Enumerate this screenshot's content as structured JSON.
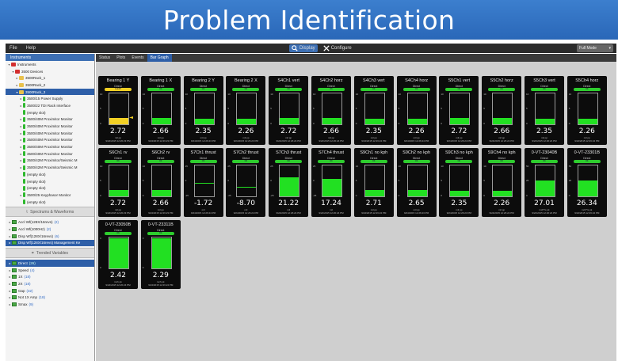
{
  "banner": {
    "title": "Problem Identification"
  },
  "menu": {
    "file": "File",
    "help": "Help",
    "display": "Display",
    "configure": "Configure",
    "mode": "Full Mode"
  },
  "left": {
    "header": "Instruments",
    "tree": [
      {
        "label": "Instruments",
        "icon": "red",
        "indent": 0,
        "tri": "▾"
      },
      {
        "label": "3500 Devices",
        "icon": "red",
        "indent": 1,
        "tri": "▾"
      },
      {
        "label": "3500Rack_1",
        "icon": "yel",
        "indent": 2,
        "tri": "▸"
      },
      {
        "label": "3500Rack_2",
        "icon": "yel",
        "indent": 2,
        "tri": "▸"
      },
      {
        "label": "3500Rack_3",
        "icon": "yel",
        "indent": 2,
        "tri": "▾",
        "selected": true
      },
      {
        "label": "3500/15 Power Supply",
        "icon": "grn",
        "indent": 3,
        "tri": "▸"
      },
      {
        "label": "3500/22 TDI Rack Interface",
        "icon": "grn",
        "indent": 3,
        "tri": "▸"
      },
      {
        "label": "(empty slot)",
        "icon": "grn",
        "indent": 3,
        "tri": ""
      },
      {
        "label": "3500/40M Proximitor Monitor",
        "icon": "grn",
        "indent": 3,
        "tri": "▸"
      },
      {
        "label": "3500/40M Proximitor Monitor",
        "icon": "grn",
        "indent": 3,
        "tri": "▸"
      },
      {
        "label": "3500/40M Proximitor Monitor",
        "icon": "grn",
        "indent": 3,
        "tri": "▸"
      },
      {
        "label": "3500/40M Proximitor Monitor",
        "icon": "grn",
        "indent": 3,
        "tri": "▸"
      },
      {
        "label": "3500/40M Proximitor Monitor",
        "icon": "grn",
        "indent": 3,
        "tri": "▸"
      },
      {
        "label": "3500/40M Proximitor Monitor",
        "icon": "grn",
        "indent": 3,
        "tri": "▸"
      },
      {
        "label": "3500/42M Proximitor/Seismic M",
        "icon": "grn",
        "indent": 3,
        "tri": "▸"
      },
      {
        "label": "3500/42M Proximitor/Seismic M",
        "icon": "grn",
        "indent": 3,
        "tri": "▸"
      },
      {
        "label": "(empty slot)",
        "icon": "grn",
        "indent": 3,
        "tri": ""
      },
      {
        "label": "(empty slot)",
        "icon": "grn",
        "indent": 3,
        "tri": ""
      },
      {
        "label": "(empty slot)",
        "icon": "grn",
        "indent": 3,
        "tri": ""
      },
      {
        "label": "3500/25 Keyphasor Monitor",
        "icon": "grn",
        "indent": 3,
        "tri": "▸"
      },
      {
        "label": "(empty slot)",
        "icon": "grn",
        "indent": 3,
        "tri": ""
      }
    ],
    "spectrums_bar": "Spectrums & Waveforms",
    "waveforms": [
      {
        "label": "Accl Wf(128X/16revs)",
        "count": "(2)"
      },
      {
        "label": "Accl Wf(1000Hz)",
        "count": "(2)"
      },
      {
        "label": "Disp Wf(128X/16revs)",
        "count": "(6)"
      },
      {
        "label": "Disp Wf(128X/16revs) Management Ke",
        "count": "",
        "selected": true
      }
    ],
    "trended_bar": "Trended Variables",
    "variables": [
      {
        "label": "Direct",
        "count": "(26)",
        "selected": true
      },
      {
        "label": "Speed",
        "count": "(4)"
      },
      {
        "label": "1X",
        "count": "(18)"
      },
      {
        "label": "2X",
        "count": "(18)"
      },
      {
        "label": "Gap",
        "count": "(32)"
      },
      {
        "label": "Not 1X Amp",
        "count": "(18)"
      },
      {
        "label": "Smax",
        "count": "(9)"
      }
    ]
  },
  "tabs": [
    "Status",
    "Plots",
    "Events",
    "Bar Graph"
  ],
  "cards": [
    {
      "name": "Bearing 1 Y",
      "badge": "ALERT",
      "alert": true,
      "value": "2.72",
      "unit": "mil pp",
      "level": 0.2,
      "ticks": [
        "10",
        "5",
        "0"
      ],
      "ts": "9/24/2015 12:26:23 PM"
    },
    {
      "name": "Bearing 1 X",
      "badge": "OK",
      "value": "2.66",
      "unit": "mil pp",
      "level": 0.2,
      "ticks": [
        "10",
        "5",
        "0"
      ],
      "ts": "9/24/2015 12:26:23 PM"
    },
    {
      "name": "Bearing 2 Y",
      "badge": "OK",
      "value": "2.35",
      "unit": "mil pp",
      "level": 0.18,
      "ticks": [
        "10",
        "5",
        "0"
      ],
      "ts": "9/24/2015 12:26:23 PM"
    },
    {
      "name": "Bearing 2 X",
      "badge": "OK",
      "value": "2.26",
      "unit": "mil pp",
      "level": 0.17,
      "ticks": [
        "10",
        "5",
        "0"
      ],
      "ts": "9/24/2015 12:26:23 PM"
    },
    {
      "name": "S4Ch1 vert",
      "badge": "OK",
      "value": "2.72",
      "unit": "mil pp",
      "level": 0.2,
      "ticks": [
        "10",
        "5",
        "0"
      ],
      "ts": "9/24/2015 12:26:24 PM"
    },
    {
      "name": "S4Ch2 horz",
      "badge": "OK",
      "value": "2.66",
      "unit": "mil pp",
      "level": 0.2,
      "ticks": [
        "10",
        "5",
        "0"
      ],
      "ts": "9/24/2015 12:26:24 PM"
    },
    {
      "name": "S4Ch3 vert",
      "badge": "OK",
      "value": "2.35",
      "unit": "mil pp",
      "level": 0.18,
      "ticks": [
        "10",
        "5",
        "0"
      ],
      "ts": "9/24/2015 12:26:24 PM"
    },
    {
      "name": "S4Ch4 horz",
      "badge": "OK",
      "value": "2.26",
      "unit": "mil pp",
      "level": 0.17,
      "ticks": [
        "10",
        "5",
        "0"
      ],
      "ts": "9/24/2015 12:26:24 PM"
    },
    {
      "name": "S5Ch1 vert",
      "badge": "OK",
      "value": "2.72",
      "unit": "mil pp",
      "level": 0.2,
      "ticks": [
        "10",
        "5",
        "0"
      ],
      "ts": "9/24/2015 12:26:24 PM"
    },
    {
      "name": "S5Ch2 horz",
      "badge": "OK",
      "value": "2.66",
      "unit": "mil pp",
      "level": 0.2,
      "ticks": [
        "10",
        "5",
        "0"
      ],
      "ts": "9/24/2015 12:26:24 PM"
    },
    {
      "name": "S5Ch3 vert",
      "badge": "OK",
      "value": "2.35",
      "unit": "mil pp",
      "level": 0.18,
      "ticks": [
        "10",
        "5",
        "0"
      ],
      "ts": "9/24/2015 12:26:24 PM"
    },
    {
      "name": "S5Ch4 horz",
      "badge": "OK",
      "value": "2.26",
      "unit": "mil pp",
      "level": 0.17,
      "ticks": [
        "10",
        "5",
        "0"
      ],
      "ts": "9/24/2015 12:26:24 PM"
    },
    {
      "name": "S6Ch1 rv",
      "badge": "OK",
      "value": "2.72",
      "unit": "mil pp",
      "level": 0.2,
      "ticks": [
        "10",
        "5",
        "0"
      ],
      "ts": "9/24/2015 12:26:23 PM"
    },
    {
      "name": "S6Ch2 rv",
      "badge": "OK",
      "value": "2.66",
      "unit": "mil pp",
      "level": 0.2,
      "ticks": [
        "10",
        "5",
        "0"
      ],
      "ts": "9/24/2015 12:26:23 PM"
    },
    {
      "name": "S7Ch1 thrust",
      "badge": "OK",
      "value": "-1.72",
      "unit": "mil",
      "zero": true,
      "level": 0.44,
      "ticks": [
        "25",
        "0",
        "-25"
      ],
      "ts": "9/24/2015 12:26:24 PM"
    },
    {
      "name": "S7Ch2 thrust",
      "badge": "OK",
      "value": "-8.70",
      "unit": "mil",
      "zero": true,
      "level": 0.33,
      "ticks": [
        "25",
        "0",
        "-25"
      ],
      "ts": "9/24/2015 12:26:24 PM"
    },
    {
      "name": "S7Ch3 thrust",
      "badge": "OK",
      "value": "21.22",
      "unit": "mil",
      "level": 0.6,
      "ticks": [
        "25",
        "0",
        "-25"
      ],
      "ts": "9/24/2015 12:26:24 PM"
    },
    {
      "name": "S7Ch4 thrust",
      "badge": "OK",
      "value": "17.24",
      "unit": "mil",
      "level": 0.55,
      "ticks": [
        "25",
        "0",
        "-25"
      ],
      "ts": "9/24/2015 12:26:24 PM"
    },
    {
      "name": "S9Ch1 no kph",
      "badge": "OK",
      "value": "2.71",
      "unit": "mil pp",
      "level": 0.2,
      "ticks": [
        "10",
        "5",
        "0"
      ],
      "ts": "9/24/2015 12:26:24 PM"
    },
    {
      "name": "S9Ch2 no kph",
      "badge": "OK",
      "value": "2.65",
      "unit": "mil pp",
      "level": 0.2,
      "ticks": [
        "10",
        "5",
        "0"
      ],
      "ts": "9/24/2015 12:26:23 PM"
    },
    {
      "name": "S9Ch3 no kph",
      "badge": "OK",
      "value": "2.35",
      "unit": "mil pp",
      "level": 0.18,
      "ticks": [
        "10",
        "5",
        "0"
      ],
      "ts": "9/24/2015 12:26:23 PM"
    },
    {
      "name": "S9Ch4 no kph",
      "badge": "OK",
      "value": "2.26",
      "unit": "mil pp",
      "level": 0.17,
      "ticks": [
        "10",
        "5",
        "0"
      ],
      "ts": "9/24/2015 12:26:24 PM"
    },
    {
      "name": "0-VT-23040B",
      "badge": "OK",
      "value": "27.01",
      "unit": "inch*/s pk",
      "level": 0.5,
      "ticks": [
        "50",
        "25",
        "0"
      ],
      "ts": "9/24/2015 12:26:24 PM"
    },
    {
      "name": "0-VT-23301B",
      "badge": "OK",
      "value": "26.34",
      "unit": "inch*/s pk",
      "level": 0.5,
      "ticks": [
        "50",
        "25",
        "0"
      ],
      "ts": "9/24/2015 12:26:24 PM"
    },
    {
      "name": "0-VT-23050B",
      "badge": "OK",
      "value": "2.42",
      "unit": "inch pk",
      "level": 0.95,
      "ticks": [
        "3",
        "",
        "0"
      ],
      "ts": "9/24/2015 12:26:24 PM"
    },
    {
      "name": "0-VT-23311B",
      "badge": "OK",
      "value": "2.29",
      "unit": "inch pk",
      "level": 0.95,
      "ticks": [
        "3",
        "",
        "0"
      ],
      "ts": "9/24/2015 12:26:24 PM"
    }
  ],
  "card_direct": "Direct"
}
